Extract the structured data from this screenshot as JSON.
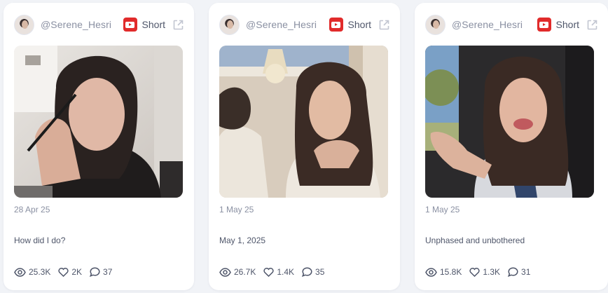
{
  "posts": [
    {
      "handle": "@Serene_Hesri",
      "type_label": "Short",
      "date": "28 Apr 25",
      "caption": "How did I do?",
      "views": "25.3K",
      "likes": "2K",
      "comments": "37"
    },
    {
      "handle": "@Serene_Hesri",
      "type_label": "Short",
      "date": "1 May 25",
      "caption": "May 1, 2025",
      "views": "26.7K",
      "likes": "1.4K",
      "comments": "35"
    },
    {
      "handle": "@Serene_Hesri",
      "type_label": "Short",
      "date": "1 May 25",
      "caption": "Unphased and unbothered",
      "views": "15.8K",
      "likes": "1.3K",
      "comments": "31"
    }
  ],
  "icons": {
    "platform": "youtube-icon",
    "external": "external-link-icon",
    "views": "eye-icon",
    "likes": "heart-icon",
    "comments": "comment-icon"
  },
  "colors": {
    "youtube_red": "#e12b2b",
    "page_background": "#f1f3f7",
    "card_background": "#ffffff",
    "muted_text": "#8a90a2",
    "body_text": "#4f566a"
  }
}
